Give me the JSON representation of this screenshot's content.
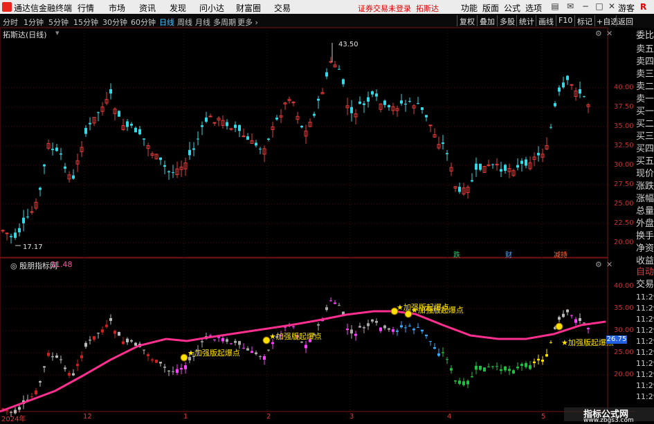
{
  "app": {
    "title": "通达信金融终端"
  },
  "menu": [
    "行情",
    "市场",
    "资讯",
    "发现",
    "问小达",
    "财富圈",
    "交易"
  ],
  "notice": "证券交易未登录",
  "notice_link": "拓斯达",
  "title_right": [
    "功能",
    "版面",
    "公式",
    "选项"
  ],
  "visitor": "游客",
  "periods": [
    "分时",
    "1分钟",
    "5分钟",
    "15分钟",
    "30分钟",
    "60分钟",
    "日线",
    "周线",
    "月线",
    "多周期",
    "更多"
  ],
  "active_period": "日线",
  "toolbar": [
    "复权",
    "叠加",
    "多股",
    "统计",
    "画线",
    "F10",
    "标记",
    "+自选",
    "返回"
  ],
  "main_panel": {
    "title": "拓斯达(日线)",
    "high_label": "43.50",
    "low_label": "17.17"
  },
  "indicator_panel": {
    "name": "殷朋指标网",
    "value": "31.48",
    "signal_text": "★加强版起爆点",
    "price_tag": "26.75"
  },
  "main_axis": [
    "40.00",
    "37.50",
    "35.00",
    "32.50",
    "30.00",
    "27.50",
    "25.00",
    "22.50",
    "20.00"
  ],
  "ind_axis": [
    "40.00",
    "35.00",
    "30.00",
    "25.00",
    "20.00"
  ],
  "events": [
    "跌",
    "财",
    "减持"
  ],
  "x_labels": [
    "2024年",
    "12",
    "1",
    "2",
    "3",
    "4",
    "5"
  ],
  "side_top": [
    "委比",
    "卖五",
    "卖四",
    "卖三",
    "卖二",
    "卖一",
    "买一",
    "买二",
    "买三",
    "买四",
    "买五",
    "现价",
    "涨跌",
    "涨幅",
    "总量",
    "外盘",
    "换手",
    "净资",
    "收益"
  ],
  "side_bottom": [
    "自动",
    "交易",
    "11:29",
    "11:29",
    "11:29",
    "11:29",
    "11:29",
    "11:29",
    "11:29",
    "11:29",
    "11:29",
    "11:29"
  ],
  "watermark": {
    "line1": "指标公式网",
    "line2": "www.zbgs3.com"
  },
  "colors": {
    "up": "#e23b3b",
    "down": "#35d9e6",
    "ma": "#ff2f8f",
    "active": "#4fc3ff",
    "signal": "#ffe000"
  }
}
